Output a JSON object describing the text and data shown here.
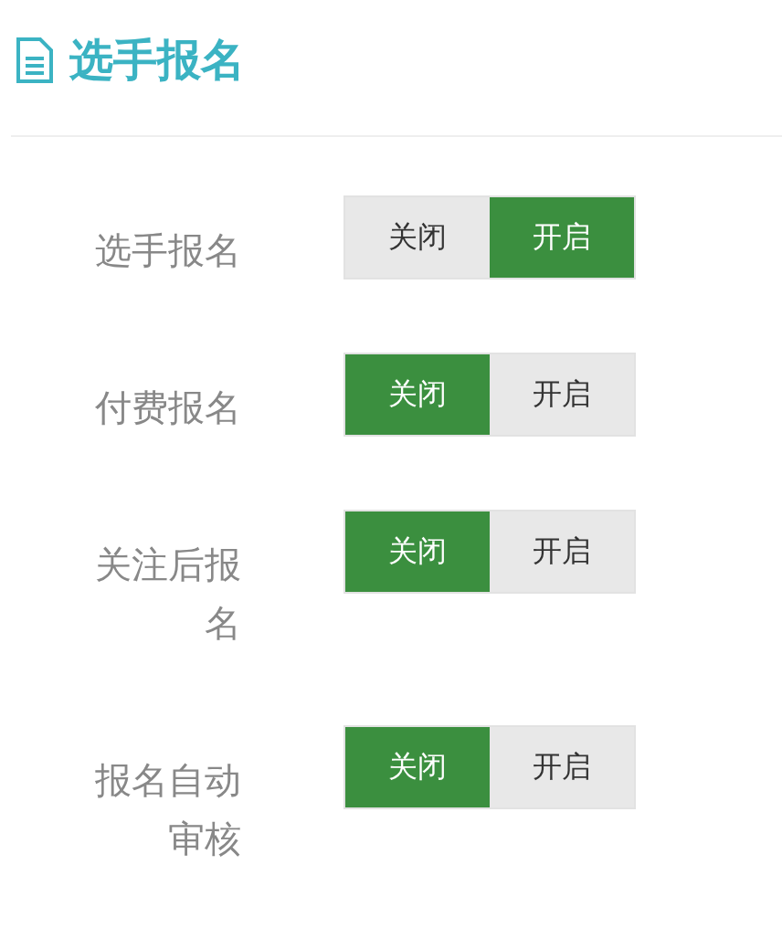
{
  "title": "选手报名",
  "settings": [
    {
      "label": "选手报名",
      "options": [
        {
          "label": "关闭",
          "selected": false
        },
        {
          "label": "开启",
          "selected": true
        }
      ]
    },
    {
      "label": "付费报名",
      "options": [
        {
          "label": "关闭",
          "selected": true
        },
        {
          "label": "开启",
          "selected": false
        }
      ]
    },
    {
      "label": "关注后报名",
      "options": [
        {
          "label": "关闭",
          "selected": true
        },
        {
          "label": "开启",
          "selected": false
        }
      ]
    },
    {
      "label": "报名自动审核",
      "options": [
        {
          "label": "关闭",
          "selected": true
        },
        {
          "label": "开启",
          "selected": false
        }
      ]
    }
  ]
}
